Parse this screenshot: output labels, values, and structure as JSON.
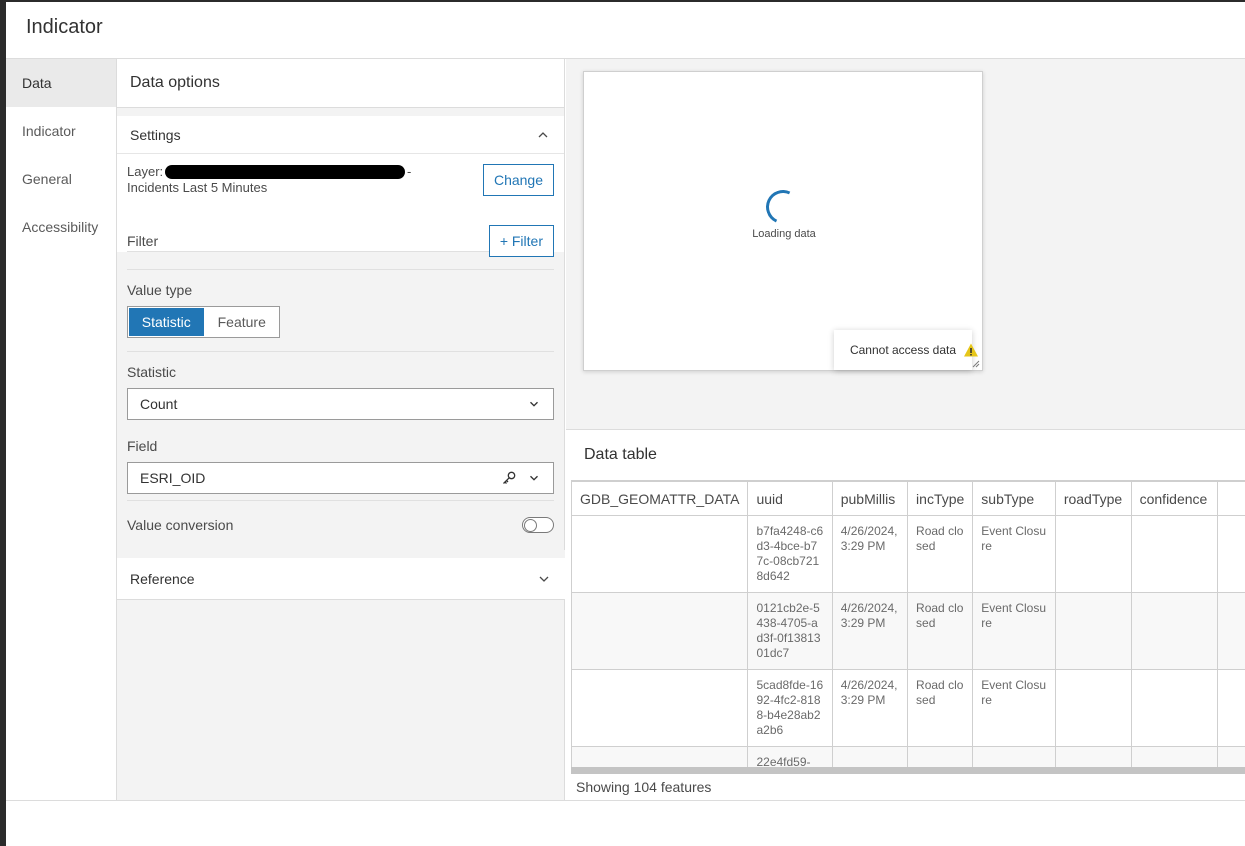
{
  "window": {
    "title": "Indicator"
  },
  "nav": {
    "items": [
      {
        "label": "Data",
        "active": true
      },
      {
        "label": "Indicator",
        "active": false
      },
      {
        "label": "General",
        "active": false
      },
      {
        "label": "Accessibility",
        "active": false
      }
    ]
  },
  "panel": {
    "title": "Data options",
    "settings": {
      "heading": "Settings",
      "layer_prefix": "Layer:",
      "layer_suffix": "-",
      "layer_name": "Incidents Last 5 Minutes",
      "change_label": "Change",
      "filter_label": "Filter",
      "add_filter_label": "+ Filter",
      "value_type_label": "Value type",
      "value_type_options": [
        "Statistic",
        "Feature"
      ],
      "value_type_selected": "Statistic",
      "statistic_label": "Statistic",
      "statistic_value": "Count",
      "field_label": "Field",
      "field_value": "ESRI_OID",
      "value_conversion_label": "Value conversion",
      "value_conversion_on": false
    },
    "reference": {
      "heading": "Reference"
    }
  },
  "preview": {
    "loading_text": "Loading data",
    "tooltip_text": "Cannot access data"
  },
  "data_table": {
    "title": "Data table",
    "columns": [
      "GDB_GEOMATTR_DATA",
      "uuid",
      "pubMillis",
      "incType",
      "subType",
      "roadType",
      "confidence",
      ""
    ],
    "rows": [
      [
        "",
        "b7fa4248-c6d3-4bce-b77c-08cb7218d642",
        "4/26/2024, 3:29 PM",
        "Road closed",
        "Event Closure",
        "",
        "",
        ""
      ],
      [
        "",
        "0121cb2e-5438-4705-ad3f-0f1381301dc7",
        "4/26/2024, 3:29 PM",
        "Road closed",
        "Event Closure",
        "",
        "",
        ""
      ],
      [
        "",
        "5cad8fde-1692-4fc2-8188-b4e28ab2a2b6",
        "4/26/2024, 3:29 PM",
        "Road closed",
        "Event Closure",
        "",
        "",
        ""
      ],
      [
        "",
        "22e4fd59-",
        "",
        "",
        "",
        "",
        "",
        ""
      ]
    ],
    "footer": "Showing 104 features"
  },
  "colors": {
    "accent": "#2176b5",
    "warning": "#e6c619"
  }
}
